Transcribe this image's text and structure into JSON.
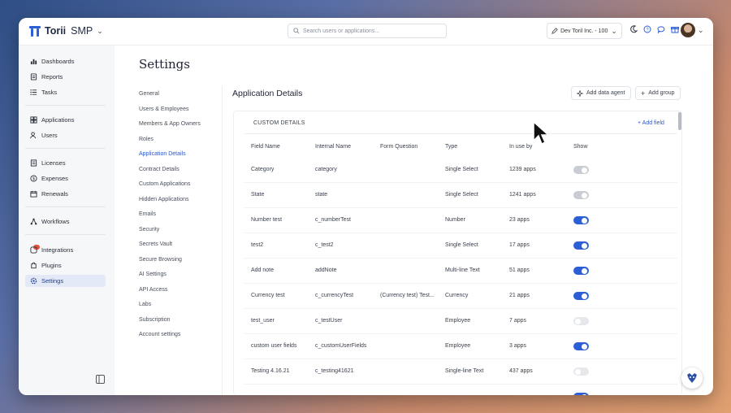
{
  "topbar": {
    "brand": "Torii",
    "product": "SMP",
    "search_placeholder": "Search users or applications...",
    "org": "Dev Toril Inc. - 100"
  },
  "sidebar": {
    "items": [
      {
        "label": "Dashboards",
        "icon": "dashboard-icon"
      },
      {
        "label": "Reports",
        "icon": "reports-icon"
      },
      {
        "label": "Tasks",
        "icon": "tasks-icon"
      },
      {
        "label": "Applications",
        "icon": "applications-icon"
      },
      {
        "label": "Users",
        "icon": "users-icon"
      },
      {
        "label": "Licenses",
        "icon": "licenses-icon"
      },
      {
        "label": "Expenses",
        "icon": "expenses-icon"
      },
      {
        "label": "Renewals",
        "icon": "renewals-icon"
      },
      {
        "label": "Workflows",
        "icon": "workflows-icon"
      },
      {
        "label": "Integrations",
        "icon": "integrations-icon"
      },
      {
        "label": "Plugins",
        "icon": "plugins-icon"
      },
      {
        "label": "Settings",
        "icon": "settings-icon"
      }
    ]
  },
  "settings": {
    "title": "Settings",
    "nav": [
      "General",
      "Users & Employees",
      "Members & App Owners",
      "Roles",
      "Application Details",
      "Contract Details",
      "Custom Applications",
      "Hidden Applications",
      "Emails",
      "Security",
      "Secrets Vault",
      "Secure Browsing",
      "AI Settings",
      "API Access",
      "Labs",
      "Subscription",
      "Account settings"
    ],
    "active": "Application Details"
  },
  "content": {
    "title": "Application Details",
    "add_agent": "Add data agent",
    "add_group": "Add group",
    "panel_title": "CUSTOM DETAILS",
    "add_field": "+ Add field",
    "columns": [
      "Field Name",
      "Internal Name",
      "Form Question",
      "Type",
      "In use by",
      "Show"
    ],
    "rows": [
      {
        "name": "Category",
        "internal": "category",
        "question": "",
        "type": "Single Select",
        "usage": "1239 apps",
        "show": "disabled"
      },
      {
        "name": "State",
        "internal": "state",
        "question": "",
        "type": "Single Select",
        "usage": "1241 apps",
        "show": "disabled"
      },
      {
        "name": "Number test",
        "internal": "c_numberTest",
        "question": "",
        "type": "Number",
        "usage": "23 apps",
        "show": "on"
      },
      {
        "name": "test2",
        "internal": "c_test2",
        "question": "",
        "type": "Single Select",
        "usage": "17 apps",
        "show": "on"
      },
      {
        "name": "Add note",
        "internal": "addNote",
        "question": "",
        "type": "Multi-line Text",
        "usage": "51 apps",
        "show": "on"
      },
      {
        "name": "Currency test",
        "internal": "c_currencyTest",
        "question": "(Currency test) Test...",
        "type": "Currency",
        "usage": "21 apps",
        "show": "on"
      },
      {
        "name": "test_user",
        "internal": "c_testUser",
        "question": "",
        "type": "Employee",
        "usage": "7 apps",
        "show": "off"
      },
      {
        "name": "custom user fields",
        "internal": "c_customUserFields",
        "question": "",
        "type": "Employee",
        "usage": "3 apps",
        "show": "on"
      },
      {
        "name": "Testing 4.16.21",
        "internal": "c_testing41621",
        "question": "",
        "type": "Single-line Text",
        "usage": "437 apps",
        "show": "off"
      }
    ]
  },
  "colors": {
    "accent": "#2c5fd6",
    "active_nav_bg": "#e3e9f6",
    "badge": "#e0523d"
  }
}
